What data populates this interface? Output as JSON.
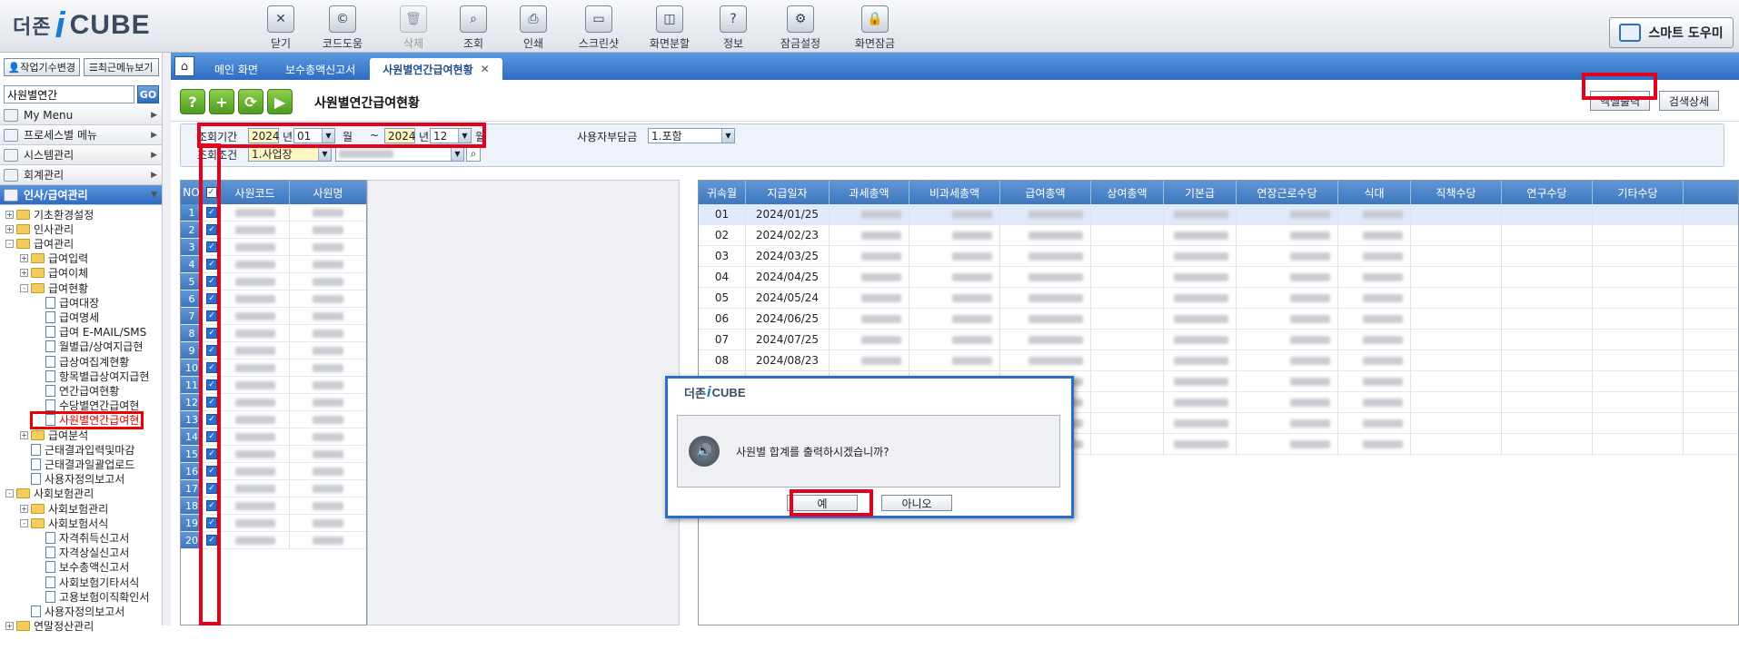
{
  "app": {
    "logo_prefix": "더존",
    "logo_i": "i",
    "logo_suffix": "CUBE",
    "smart_help": "스마트 도우미"
  },
  "toolbar": [
    {
      "label": "닫기",
      "icon": "close-window-icon",
      "disabled": false
    },
    {
      "label": "코드도움",
      "icon": "code-help-icon",
      "disabled": false
    },
    {
      "label": "삭제",
      "icon": "trash-icon",
      "disabled": true
    },
    {
      "label": "조회",
      "icon": "search-icon",
      "disabled": false
    },
    {
      "label": "인쇄",
      "icon": "printer-icon",
      "disabled": false
    },
    {
      "label": "스크린샷",
      "icon": "monitor-icon",
      "disabled": false
    },
    {
      "label": "화면분할",
      "icon": "split-screen-icon",
      "disabled": false
    },
    {
      "label": "정보",
      "icon": "info-icon",
      "disabled": false
    },
    {
      "label": "잠금설정",
      "icon": "lock-settings-icon",
      "disabled": false
    },
    {
      "label": "화면잠금",
      "icon": "lock-icon",
      "disabled": false
    }
  ],
  "sidebar": {
    "btn_change": "작업기수변경",
    "btn_recent": "최근메뉴보기",
    "search_value": "사원별연간",
    "search_go": "GO",
    "groups": [
      {
        "label": "My Menu"
      },
      {
        "label": "프로세스별 메뉴"
      },
      {
        "label": "시스템관리"
      },
      {
        "label": "회계관리"
      },
      {
        "label": "인사/급여관리"
      }
    ],
    "tree": [
      {
        "label": "기초환경설정",
        "type": "folder",
        "level": 0,
        "exp": "+"
      },
      {
        "label": "인사관리",
        "type": "folder",
        "level": 0,
        "exp": "+"
      },
      {
        "label": "급여관리",
        "type": "folder",
        "level": 0,
        "exp": "-"
      },
      {
        "label": "급여입력",
        "type": "folder",
        "level": 1,
        "exp": "+"
      },
      {
        "label": "급여이체",
        "type": "folder",
        "level": 1,
        "exp": "+"
      },
      {
        "label": "급여현황",
        "type": "folder",
        "level": 1,
        "exp": "-"
      },
      {
        "label": "급여대장",
        "type": "doc",
        "level": 2
      },
      {
        "label": "급여명세",
        "type": "doc",
        "level": 2
      },
      {
        "label": "급여 E-MAIL/SMS",
        "type": "doc",
        "level": 2
      },
      {
        "label": "월별급/상여지급현",
        "type": "doc",
        "level": 2
      },
      {
        "label": "급상여집계현황",
        "type": "doc",
        "level": 2
      },
      {
        "label": "항목별급상여지급현",
        "type": "doc",
        "level": 2
      },
      {
        "label": "연간급여현황",
        "type": "doc",
        "level": 2
      },
      {
        "label": "수당별연간급여현",
        "type": "doc",
        "level": 2
      },
      {
        "label": "사원별연간급여현",
        "type": "doc",
        "level": 2,
        "hl": true
      },
      {
        "label": "급여분석",
        "type": "folder",
        "level": 1,
        "exp": "+"
      },
      {
        "label": "근태결과입력및마감",
        "type": "doc",
        "level": 1
      },
      {
        "label": "근태결과일괄업로드",
        "type": "doc",
        "level": 1
      },
      {
        "label": "사용자정의보고서",
        "type": "doc",
        "level": 1
      },
      {
        "label": "사회보험관리",
        "type": "folder",
        "level": 0,
        "exp": "-"
      },
      {
        "label": "사회보험관리",
        "type": "folder",
        "level": 1,
        "exp": "+"
      },
      {
        "label": "사회보험서식",
        "type": "folder",
        "level": 1,
        "exp": "-"
      },
      {
        "label": "자격취득신고서",
        "type": "doc",
        "level": 2
      },
      {
        "label": "자격상실신고서",
        "type": "doc",
        "level": 2
      },
      {
        "label": "보수총액신고서",
        "type": "doc",
        "level": 2
      },
      {
        "label": "사회보험기타서식",
        "type": "doc",
        "level": 2
      },
      {
        "label": "고용보험이직확인서",
        "type": "doc",
        "level": 2
      },
      {
        "label": "사용자정의보고서",
        "type": "doc",
        "level": 1
      },
      {
        "label": "연말정산관리",
        "type": "folder",
        "level": 0,
        "exp": "+"
      }
    ]
  },
  "tabs": [
    {
      "label": "메인 화면",
      "active": false
    },
    {
      "label": "보수총액신고서",
      "active": false
    },
    {
      "label": "사원별연간급여현황",
      "active": true
    }
  ],
  "page": {
    "title": "사원별연간급여현황",
    "excel_btn": "엑셀출력",
    "search_detail_btn": "검색상세"
  },
  "conditions": {
    "period_label": "조회기간",
    "from_year": "2024",
    "year_unit": "년",
    "from_month": "01",
    "month_unit": "월",
    "tilde": "~",
    "to_year": "2024",
    "to_month": "12",
    "employer_label": "사용자부담금",
    "employer_value": "1.포함",
    "cond_label": "조회조건",
    "cond_value": "1.사업장"
  },
  "left_grid": {
    "col_no": "NO",
    "col_code": "사원코드",
    "col_name": "사원명",
    "rows": [
      "1",
      "2",
      "3",
      "4",
      "5",
      "6",
      "7",
      "8",
      "9",
      "10",
      "11",
      "12",
      "13",
      "14",
      "15",
      "16",
      "17",
      "18",
      "19",
      "20"
    ]
  },
  "right_grid": {
    "columns": [
      "귀속월",
      "지급일자",
      "과세총액",
      "비과세총액",
      "급여총액",
      "상여총액",
      "기본급",
      "연장근로수당",
      "식대",
      "직책수당",
      "연구수당",
      "기타수당"
    ],
    "rows": [
      {
        "month": "01",
        "date": "2024/01/25"
      },
      {
        "month": "02",
        "date": "2024/02/23"
      },
      {
        "month": "03",
        "date": "2024/03/25"
      },
      {
        "month": "04",
        "date": "2024/04/25"
      },
      {
        "month": "05",
        "date": "2024/05/24"
      },
      {
        "month": "06",
        "date": "2024/06/25"
      },
      {
        "month": "07",
        "date": "2024/07/25"
      },
      {
        "month": "08",
        "date": "2024/08/23"
      },
      {
        "month": "",
        "date": ""
      },
      {
        "month": "",
        "date": ""
      },
      {
        "month": "",
        "date": ""
      },
      {
        "month": "",
        "date": ""
      }
    ]
  },
  "dialog": {
    "logo_prefix": "더존",
    "logo_i": "i",
    "logo_suffix": "CUBE",
    "message": "사원별 합계를 출력하시겠습니까?",
    "yes": "예",
    "no": "아니오"
  }
}
